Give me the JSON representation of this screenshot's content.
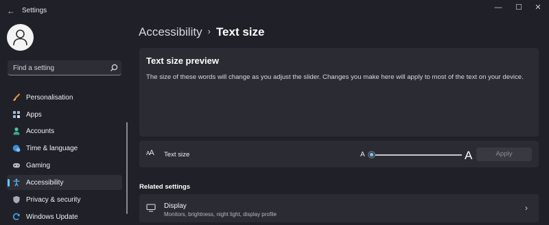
{
  "window": {
    "title": "Settings",
    "back_glyph": "←",
    "minimize_glyph": "—",
    "maximize_glyph": "☐",
    "close_glyph": "✕"
  },
  "search": {
    "placeholder": "Find a setting",
    "icon": "search-icon"
  },
  "sidebar": {
    "items": [
      {
        "label": "Personalisation",
        "icon": "paintbrush-icon",
        "active": false
      },
      {
        "label": "Apps",
        "icon": "apps-icon",
        "active": false
      },
      {
        "label": "Accounts",
        "icon": "person-icon",
        "active": false
      },
      {
        "label": "Time & language",
        "icon": "globe-clock-icon",
        "active": false
      },
      {
        "label": "Gaming",
        "icon": "gamepad-icon",
        "active": false
      },
      {
        "label": "Accessibility",
        "icon": "accessibility-icon",
        "active": true
      },
      {
        "label": "Privacy & security",
        "icon": "shield-icon",
        "active": false
      },
      {
        "label": "Windows Update",
        "icon": "refresh-icon",
        "active": false
      }
    ]
  },
  "breadcrumb": {
    "parent": "Accessibility",
    "separator": "›",
    "current": "Text size"
  },
  "preview": {
    "title": "Text size preview",
    "description": "The size of these words will change as you adjust the slider. Changes you make here will apply to most of the text on your device."
  },
  "text_size": {
    "label": "Text size",
    "min_glyph": "A",
    "max_glyph": "A",
    "slider_value_fraction": 0.0,
    "apply_label": "Apply",
    "apply_enabled": false
  },
  "related": {
    "title": "Related settings",
    "items": [
      {
        "title": "Display",
        "subtitle": "Monitors, brightness, night light, display profile",
        "icon": "monitor-icon",
        "chevron": "›"
      }
    ]
  },
  "colors": {
    "accent": "#60cdff",
    "background": "#202128",
    "card": "#2b2c33"
  }
}
